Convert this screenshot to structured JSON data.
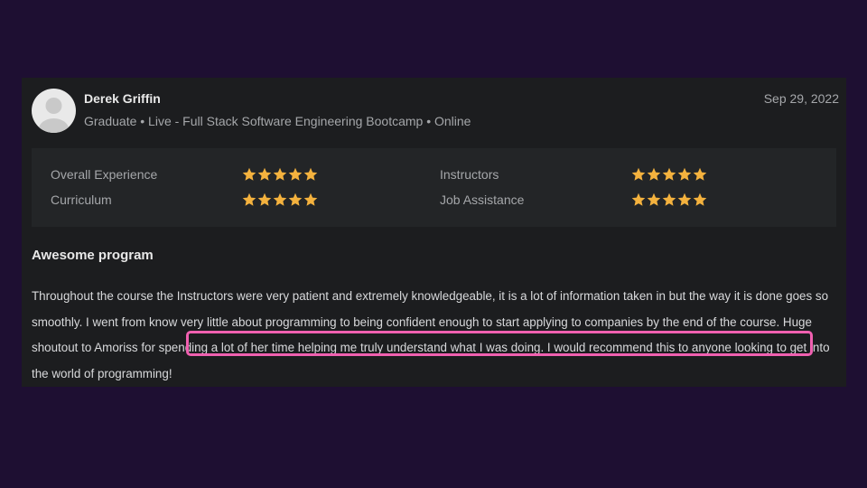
{
  "reviewer": {
    "name": "Derek Griffin",
    "meta": "Graduate • Live - Full Stack Software Engineering Bootcamp • Online",
    "avatar_icon": "user-avatar-icon"
  },
  "review": {
    "date": "Sep 29, 2022",
    "title": "Awesome program",
    "body": "Throughout the course the Instructors were very patient and extremely knowledgeable, it is a lot of information taken in but the way it is done goes so smoothly. I went from know very little about programming to being confident enough to start applying to companies by the end of the course. Huge shoutout to Amoriss for spending a lot of her time helping me truly understand what I was doing. I would recommend this to anyone looking to get into the world of programming!"
  },
  "ratings": [
    {
      "label": "Overall Experience",
      "stars": 5
    },
    {
      "label": "Instructors",
      "stars": 5
    },
    {
      "label": "Curriculum",
      "stars": 5
    },
    {
      "label": "Job Assistance",
      "stars": 5
    }
  ],
  "colors": {
    "page_background": "#1e0f32",
    "card_background": "#1c1d1f",
    "star": "#f4b23e",
    "highlight_border": "#f060b0"
  }
}
